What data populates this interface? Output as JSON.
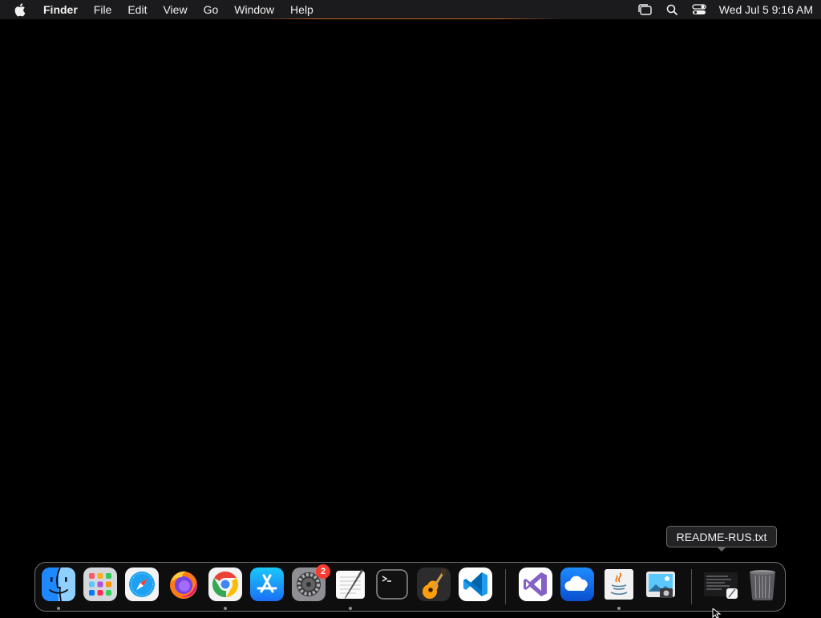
{
  "menubar": {
    "apple_icon": "apple-logo-icon",
    "items": [
      {
        "label": "Finder",
        "bold": true
      },
      {
        "label": "File"
      },
      {
        "label": "Edit"
      },
      {
        "label": "View"
      },
      {
        "label": "Go"
      },
      {
        "label": "Window"
      },
      {
        "label": "Help"
      }
    ],
    "status_icons": [
      "stage-manager-icon",
      "spotlight-search-icon",
      "control-center-icon"
    ],
    "clock": "Wed Jul 5  9:16 AM"
  },
  "dock": {
    "apps": [
      {
        "name": "finder",
        "running": true
      },
      {
        "name": "launchpad",
        "running": false
      },
      {
        "name": "safari",
        "running": false
      },
      {
        "name": "firefox",
        "running": false
      },
      {
        "name": "chrome",
        "running": true
      },
      {
        "name": "app-store",
        "running": false
      },
      {
        "name": "system-preferences",
        "running": false,
        "badge": "2"
      },
      {
        "name": "textedit",
        "running": true
      },
      {
        "name": "terminal",
        "running": false
      },
      {
        "name": "garageband",
        "running": false
      },
      {
        "name": "vscode",
        "running": false
      },
      {
        "name": "visual-studio",
        "running": false
      },
      {
        "name": "weather",
        "running": false
      },
      {
        "name": "java",
        "running": true
      },
      {
        "name": "preview",
        "running": false
      },
      {
        "name": "readme-file",
        "running": false
      },
      {
        "name": "trash",
        "running": false
      }
    ],
    "colors": {
      "badge": "#ff3b30",
      "dock_border": "#c8c8c8"
    }
  },
  "tooltip": {
    "text": "README-RUS.txt"
  }
}
